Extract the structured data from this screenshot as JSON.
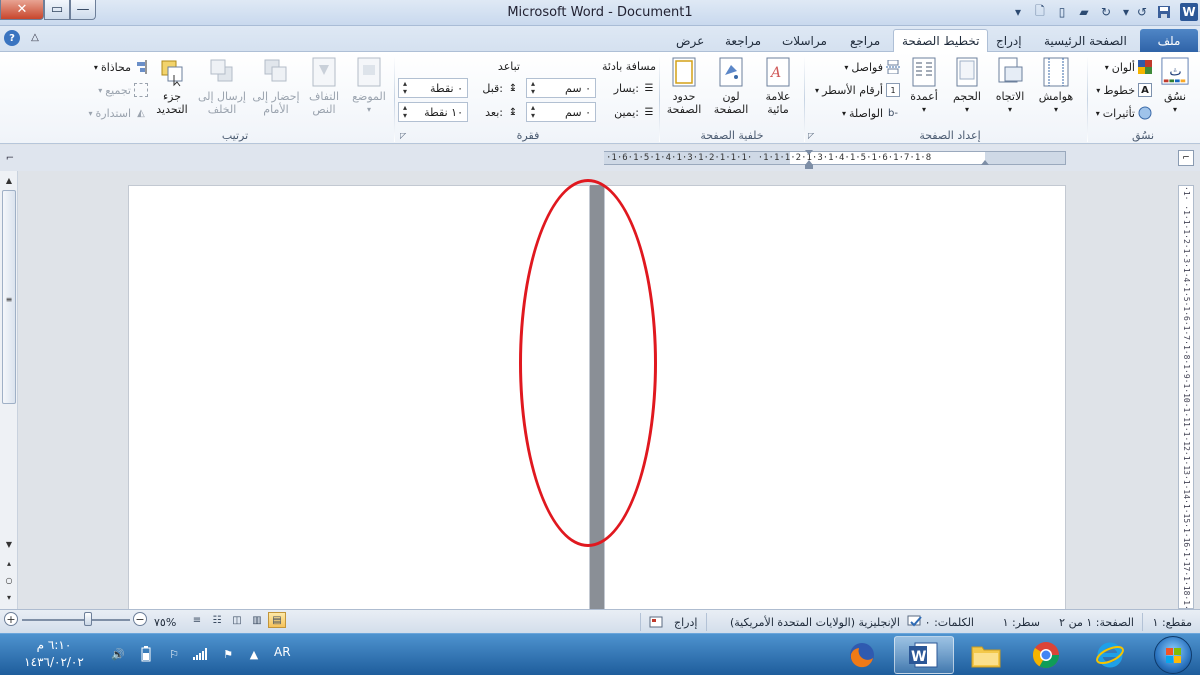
{
  "window": {
    "title": "Microsoft Word  -  Document1",
    "close": "✕",
    "maximize": "▭",
    "minimize": "—"
  },
  "tabs": {
    "file": "ملف",
    "home": "الصفحة الرئيسية",
    "insert": "إدراج",
    "page_layout": "تخطيط الصفحة",
    "references": "مراجع",
    "mailings": "مراسلات",
    "review": "مراجعة",
    "view": "عرض"
  },
  "ribbon": {
    "themes": {
      "label": "نسُق",
      "themes_btn": "نسُق",
      "colors": "ألوان",
      "fonts": "خطوط",
      "effects": "تأثيرات"
    },
    "page_setup": {
      "label": "إعداد الصفحة",
      "margins": "هوامش",
      "orientation": "الاتجاه",
      "size": "الحجم",
      "columns": "أعمدة",
      "breaks": "فواصل",
      "line_numbers": "أرقام الأسطر",
      "hyphenation": "الواصلة"
    },
    "page_background": {
      "label": "خلفية الصفحة",
      "watermark": [
        "علامة",
        "مائية"
      ],
      "page_color": [
        "لون",
        "الصفحة"
      ],
      "page_borders": [
        "حدود",
        "الصفحة"
      ]
    },
    "paragraph": {
      "label": "فقرة",
      "indent_title": "مسافة بادئة",
      "left_label": "يسار:",
      "left_value": "٠ سم",
      "right_label": "يمين:",
      "right_value": "٠ سم",
      "spacing_title": "تباعد",
      "before_label": "قبل:",
      "before_value": "٠ نقطة",
      "after_label": "بعد:",
      "after_value": "١٠ نقطة"
    },
    "arrange": {
      "label": "ترتيب",
      "position": "الموضع",
      "wrap_text": [
        "التفاف",
        "النص"
      ],
      "bring_forward": [
        "إحضار إلى",
        "الأمام"
      ],
      "send_backward": [
        "إرسال إلى",
        "الخلف"
      ],
      "selection_pane": [
        "جزء",
        "التحديد"
      ],
      "align": "محاذاة",
      "group": "تجميع",
      "rotate": "استدارة"
    }
  },
  "ruler": {
    "text": "·1·6·1·5·1·4·1·3·1·2·1·1·1·  ·1·1·1·2·1·3·1·4·1·5·1·6·1·7·1·8",
    "vertical": "·1·  ·1·1·1·2·1·3·1·4·1·5·1·6·1·7·1·8·1·9·1·10·1·11·1·12·1·13·1·14·1·15·1·16·1·17·1·18·1·19·1·20·1·21"
  },
  "statusbar": {
    "section": "مقطع: ١",
    "page": "الصفحة: ١ من ٢",
    "line": "سطر: ١",
    "words": "الكلمات: ٠",
    "language": "الإنجليزية (الولايات المتحدة الأمريكية)",
    "mode": "إدراج",
    "zoom": "٧٥%"
  },
  "taskbar": {
    "time": "٦:١٠ م",
    "date": "١٤٣٦/٠٢/٠٢",
    "lang": "AR"
  },
  "colors": {
    "annotation": "#e0181f",
    "file_tab": "#2f63a8",
    "taskbar": "#1e5d9c"
  }
}
